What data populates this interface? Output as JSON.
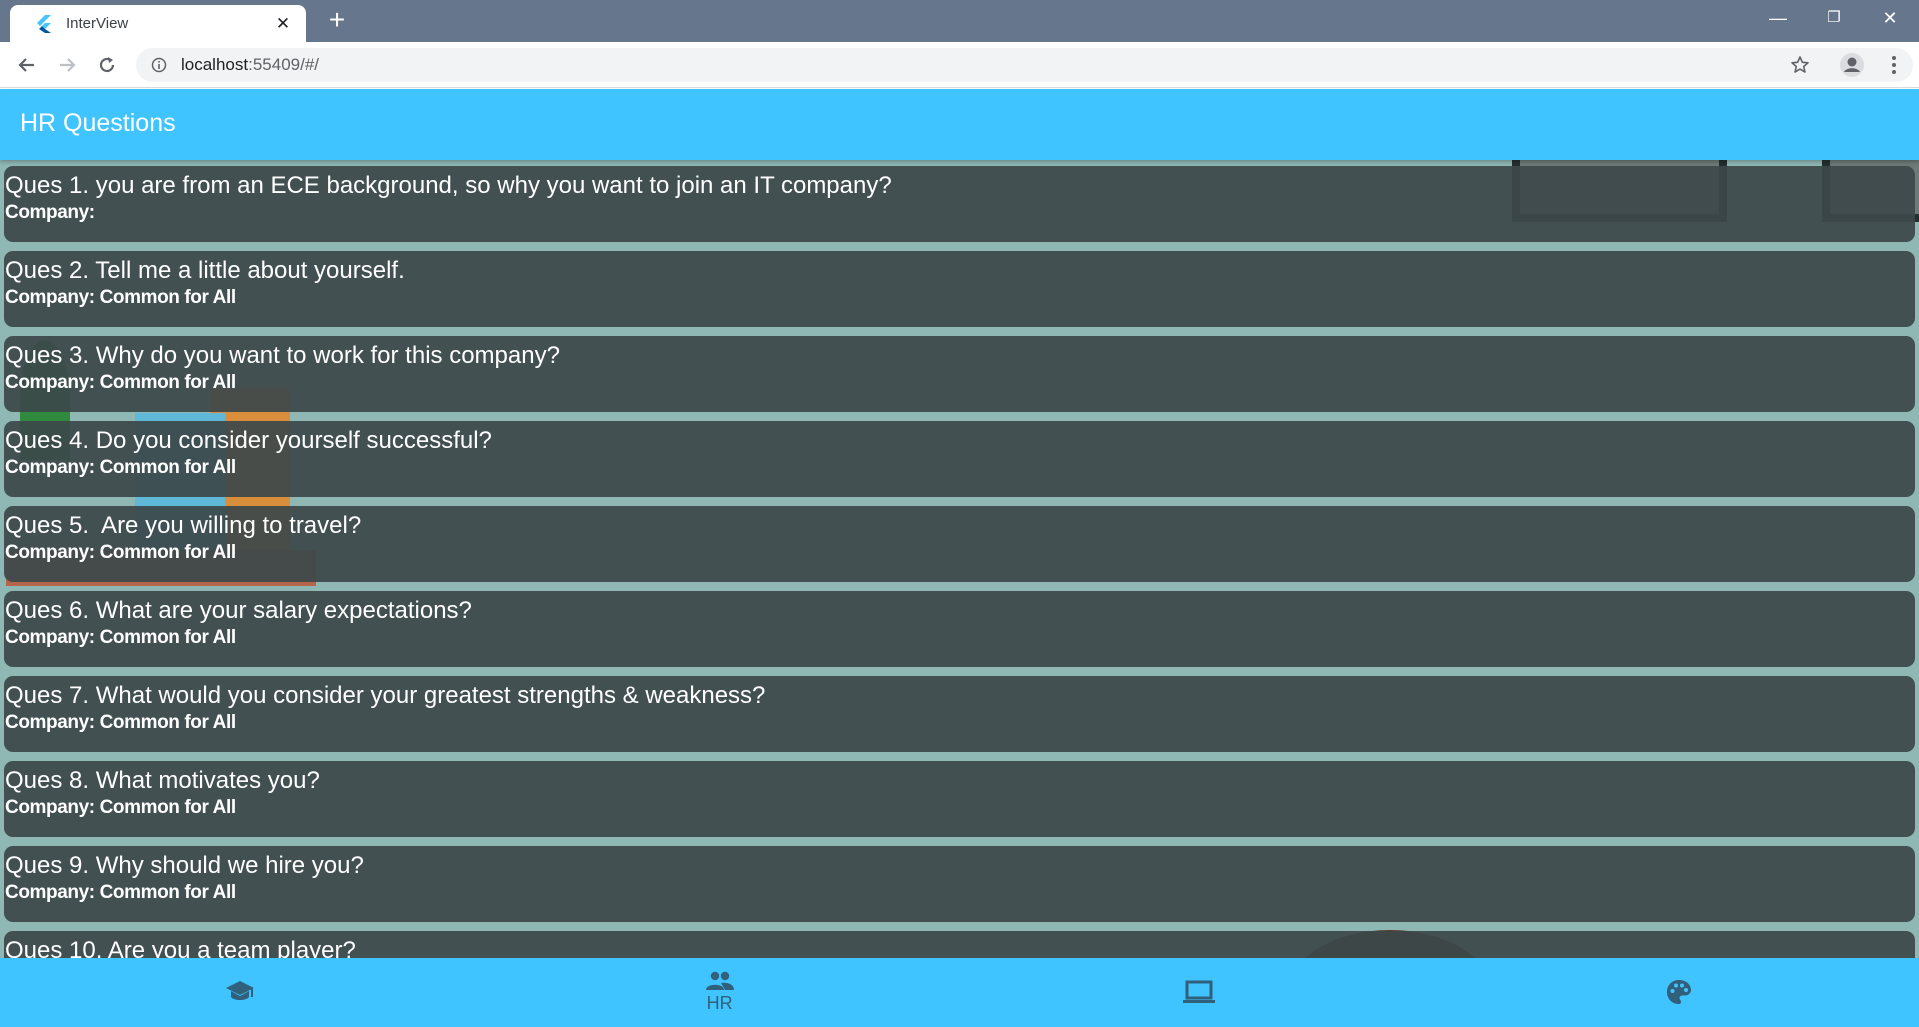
{
  "browser": {
    "tab_title": "InterView",
    "url_host": "localhost",
    "url_rest": ":55409/#/",
    "icons": {
      "favicon": "flutter-icon",
      "close": "close-icon",
      "new_tab": "plus-icon",
      "back": "arrow-back-icon",
      "forward": "arrow-forward-icon",
      "reload": "reload-icon",
      "info": "info-icon",
      "bookmark": "star-icon",
      "profile": "account-icon",
      "menu": "kebab-menu-icon"
    },
    "window_controls": {
      "minimize": "—",
      "restore": "❐",
      "close": "✕"
    }
  },
  "app": {
    "title": "HR Questions",
    "colors": {
      "primary": "#40c4ff",
      "card": "#3c484a",
      "card_text": "#ffffff",
      "nav_icon": "#31607c"
    },
    "company_prefix": "Company:",
    "questions": [
      {
        "label": "Ques 1. you are from an ECE background, so why you want to join an IT company?",
        "company": "Company:"
      },
      {
        "label": "Ques 2. Tell me a little about yourself.",
        "company": "Company: Common for All"
      },
      {
        "label": "Ques 3. Why do you want to work for this company?",
        "company": "Company: Common for All"
      },
      {
        "label": "Ques 4. Do you consider yourself successful?",
        "company": "Company: Common for All"
      },
      {
        "label": "Ques 5.  Are you willing to travel?",
        "company": "Company: Common for All"
      },
      {
        "label": "Ques 6. What are your salary expectations?",
        "company": "Company: Common for All"
      },
      {
        "label": "Ques 7. What would you consider your greatest strengths & weakness?",
        "company": "Company: Common for All"
      },
      {
        "label": "Ques 8. What motivates you?",
        "company": "Company: Common for All"
      },
      {
        "label": "Ques 9. Why should we hire you?",
        "company": "Company: Common for All"
      },
      {
        "label": "Ques 10. Are you a team player?",
        "company": ""
      }
    ],
    "bottom_nav": [
      {
        "icon": "school-icon",
        "label": ""
      },
      {
        "icon": "people-icon",
        "label": "HR"
      },
      {
        "icon": "laptop-icon",
        "label": ""
      },
      {
        "icon": "palette-icon",
        "label": ""
      }
    ]
  }
}
